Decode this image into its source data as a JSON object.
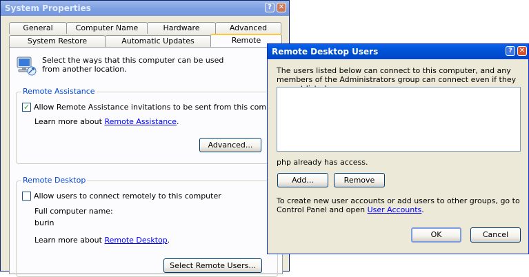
{
  "system_properties": {
    "title": "System Properties",
    "tabs_back": [
      "General",
      "Computer Name",
      "Hardware",
      "Advanced"
    ],
    "tabs_front": [
      "System Restore",
      "Automatic Updates",
      "Remote"
    ],
    "selected_tab": "Remote",
    "intro": "Select the ways that this computer can be used from another location.",
    "remote_assistance": {
      "legend": "Remote Assistance",
      "checkbox_label": "Allow Remote Assistance invitations to be sent from this computer",
      "checked": true,
      "learn_prefix": "Learn more about",
      "learn_link": "Remote Assistance",
      "learn_suffix": ".",
      "advanced_button": "Advanced..."
    },
    "remote_desktop": {
      "legend": "Remote Desktop",
      "checkbox_label": "Allow users to connect remotely to this computer",
      "checked": false,
      "full_name_label": "Full computer name:",
      "computer_name": "burin",
      "learn_prefix": "Learn more about",
      "learn_link": "Remote Desktop",
      "learn_suffix": ".",
      "select_users_button": "Select Remote Users..."
    }
  },
  "remote_desktop_users": {
    "title": "Remote Desktop Users",
    "description": "The users listed below can connect to this computer, and any members of the Administrators group can connect even if they are not listed.",
    "users": [],
    "access_note": "php already has access.",
    "add_button": "Add...",
    "remove_button": "Remove",
    "footer_text": "To create new user accounts or add users to other groups, go to Control Panel and open",
    "footer_link": "User Accounts",
    "footer_suffix": ".",
    "ok_button": "OK",
    "cancel_button": "Cancel"
  },
  "icons": {
    "help": "?",
    "close": "✕",
    "check": "✓"
  },
  "colors": {
    "active_title": "#0053d8",
    "inactive_title": "#7c9fe2",
    "group_legend": "#0046d5",
    "link": "#0000ff",
    "window_bg": "#ece9d8"
  }
}
